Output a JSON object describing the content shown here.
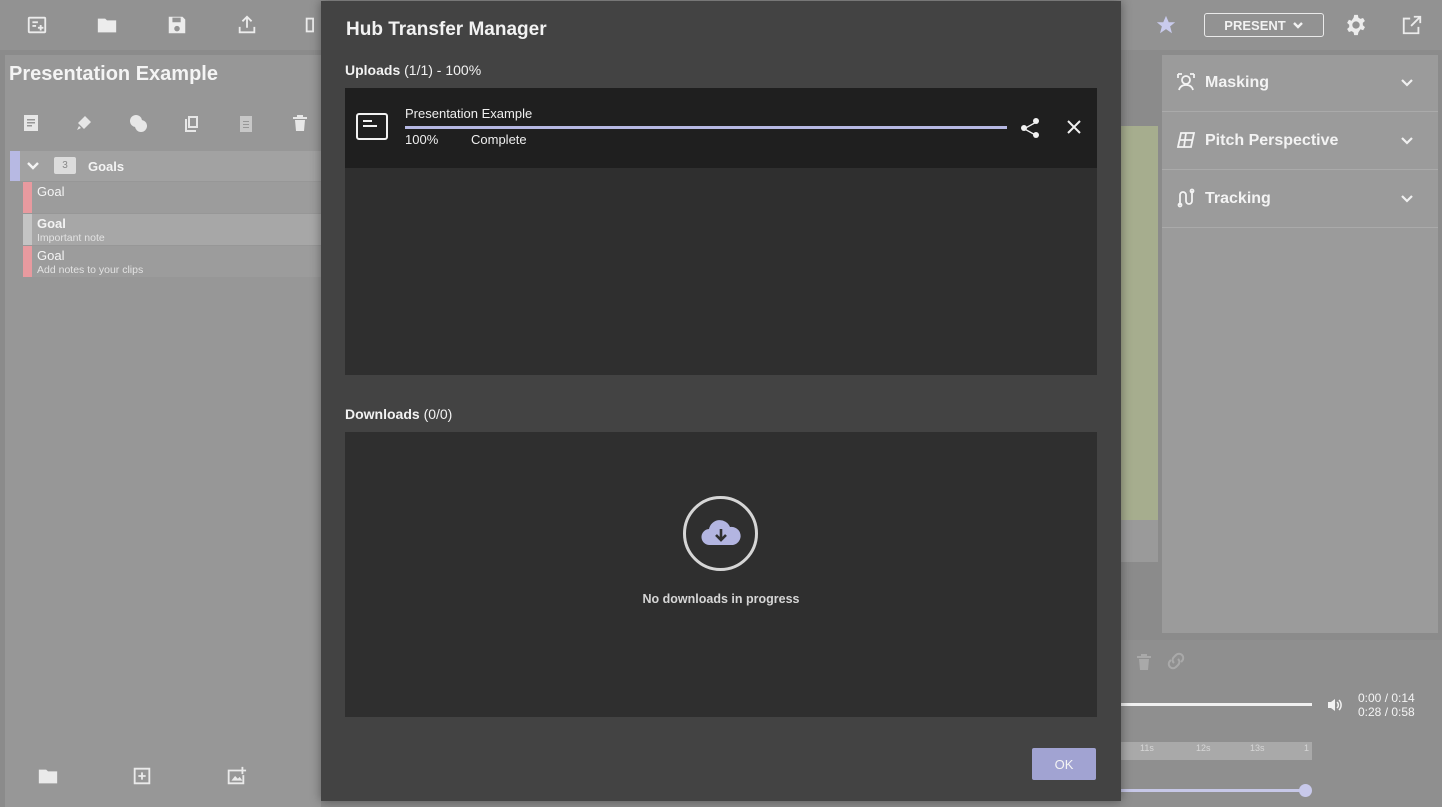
{
  "modal": {
    "title": "Hub Transfer Manager",
    "uploads_label": "Uploads",
    "uploads_count": "(1/1) - 100%",
    "downloads_label": "Downloads",
    "downloads_count": "(0/0)",
    "upload_items": [
      {
        "name": "Presentation Example",
        "percent_text": "100%",
        "progress": 1.0,
        "status": "Complete"
      }
    ],
    "empty_downloads_text": "No downloads in progress",
    "ok_label": "OK"
  },
  "toolbar": {
    "present_label": "PRESENT",
    "icons": [
      "new-note-icon",
      "folder-icon",
      "save-icon",
      "upload-icon",
      "layout-icon",
      "star-icon",
      "gear-icon",
      "external-link-icon"
    ]
  },
  "left_panel": {
    "title": "Presentation Example",
    "group": {
      "count": "3",
      "label": "Goals"
    },
    "clips": [
      {
        "title": "Goal",
        "note": ""
      },
      {
        "title": "Goal",
        "note": "Important note"
      },
      {
        "title": "Goal",
        "note": "Add notes to your clips"
      }
    ]
  },
  "right_panel": {
    "sections": [
      {
        "label": "Masking",
        "icon": "masking-icon"
      },
      {
        "label": "Pitch Perspective",
        "icon": "pitch-icon"
      },
      {
        "label": "Tracking",
        "icon": "tracking-icon"
      }
    ]
  },
  "player": {
    "time_clip": "0:00 / 0:14",
    "time_total": "0:28 / 0:58",
    "ruler_ticks": [
      "11s",
      "12s",
      "13s",
      "1"
    ]
  },
  "colors": {
    "accent": "#a1a3d2",
    "modal_bg": "#434343",
    "list_bg": "#2f2f2f",
    "clip_marker": "#e89a9f"
  }
}
